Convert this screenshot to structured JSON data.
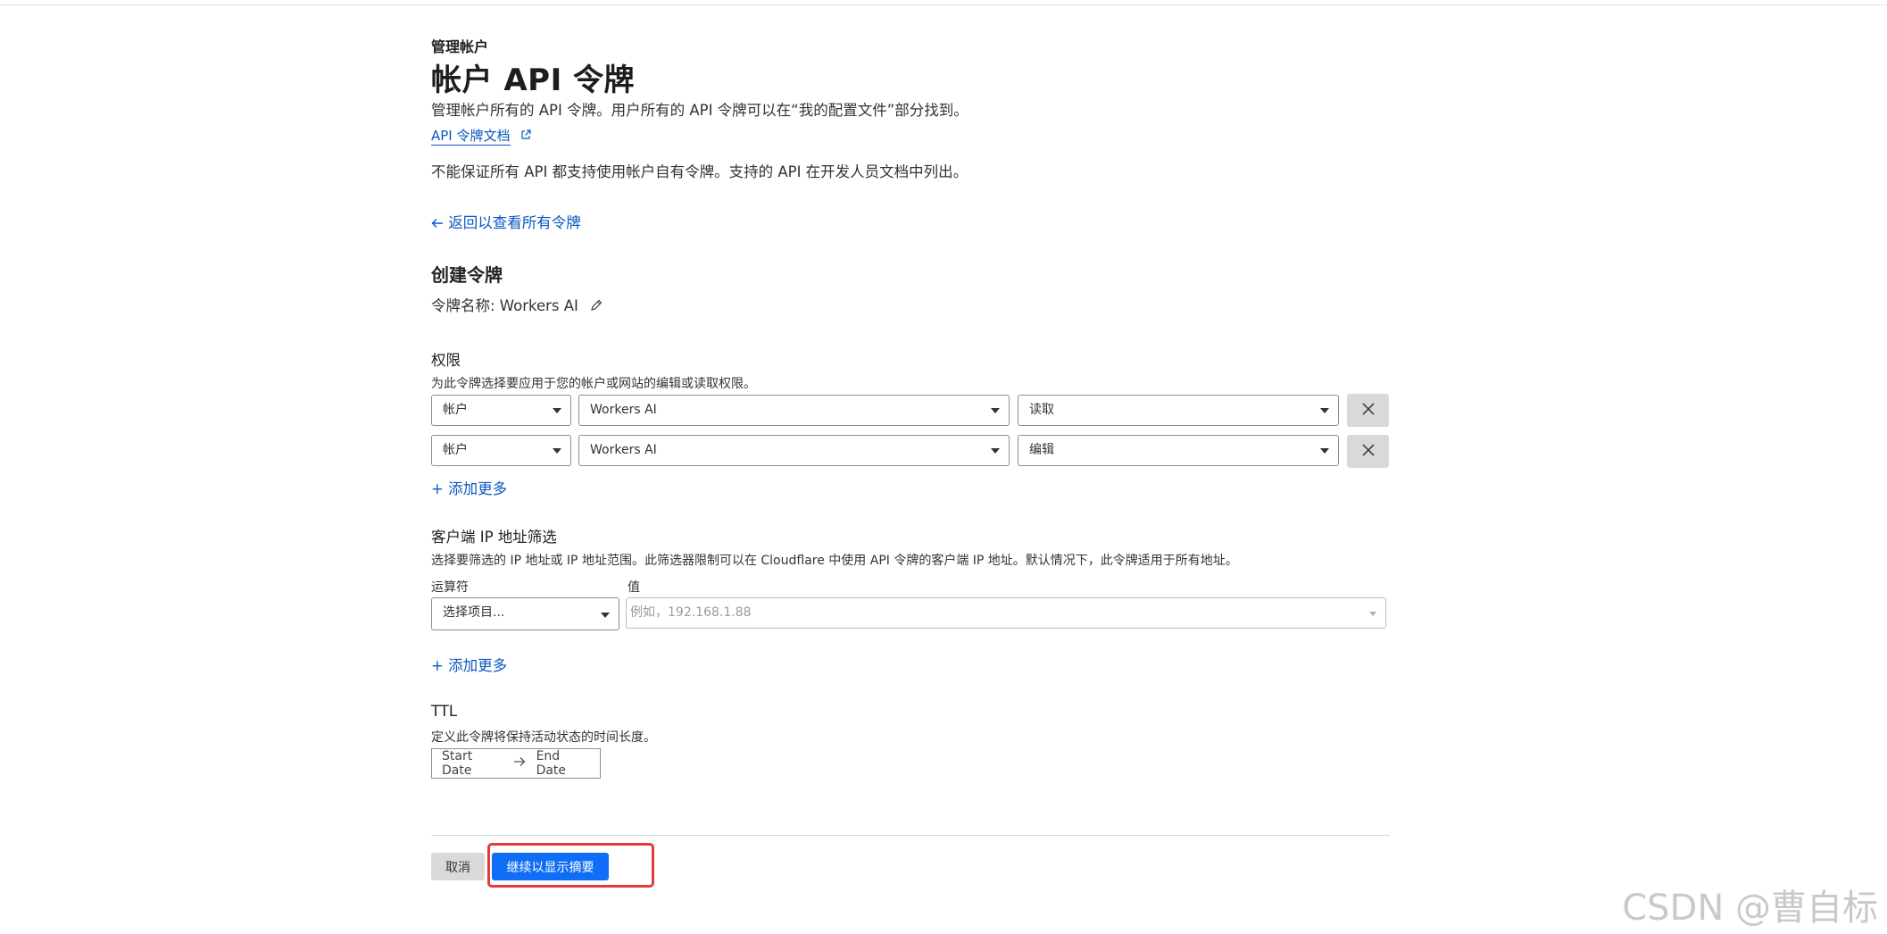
{
  "header": {
    "breadcrumb": "管理帐户",
    "title": "帐户 API 令牌",
    "description": "管理帐户所有的 API 令牌。用户所有的 API 令牌可以在“我的配置文件”部分找到。",
    "doc_link": "API 令牌文档",
    "note": "不能保证所有 API 都支持使用帐户自有令牌。支持的 API 在开发人员文档中列出。",
    "back_link": "返回以查看所有令牌"
  },
  "create": {
    "heading": "创建令牌",
    "token_name": "令牌名称: Workers AI"
  },
  "permissions": {
    "title": "权限",
    "description": "为此令牌选择要应用于您的帐户或网站的编辑或读取权限。",
    "rows": [
      {
        "scope": "帐户",
        "resource": "Workers AI",
        "level": "读取"
      },
      {
        "scope": "帐户",
        "resource": "Workers AI",
        "level": "编辑"
      }
    ],
    "add_more": "+ 添加更多"
  },
  "ip_filter": {
    "title": "客户端 IP 地址筛选",
    "description": "选择要筛选的 IP 地址或 IP 地址范围。此筛选器限制可以在 Cloudflare 中使用 API 令牌的客户端 IP 地址。默认情况下，此令牌适用于所有地址。",
    "operator_label": "运算符",
    "value_label": "值",
    "operator_placeholder": "选择项目...",
    "value_placeholder": "例如，192.168.1.88",
    "add_more": "+ 添加更多"
  },
  "ttl": {
    "title": "TTL",
    "description": "定义此令牌将保持活动状态的时间长度。",
    "start_placeholder": "Start Date",
    "end_placeholder": "End Date"
  },
  "footer": {
    "cancel": "取消",
    "continue": "继续以显示摘要"
  },
  "watermark": "CSDN @曹自标",
  "colors": {
    "link": "#0a57c2",
    "primary_button": "#0f6ef5",
    "highlight": "#e23b3b"
  }
}
